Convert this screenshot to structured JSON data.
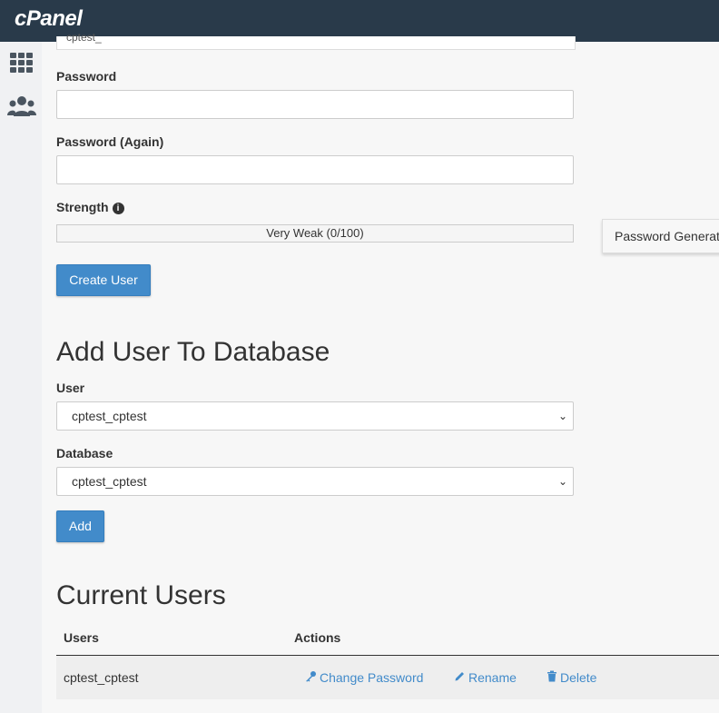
{
  "app": {
    "logo_text": "cPanel"
  },
  "colors": {
    "topbar": "#293a4a",
    "primary": "#428bca",
    "link": "#428bca"
  },
  "sidebar": {
    "items": [
      {
        "icon": "grid-icon"
      },
      {
        "icon": "users-icon"
      }
    ]
  },
  "create_user": {
    "username_partial": "cptest_",
    "password_label": "Password",
    "password_value": "",
    "password_again_label": "Password (Again)",
    "password_again_value": "",
    "strength_label": "Strength",
    "strength_text": "Very Weak (0/100)",
    "strength_value": 0,
    "generator_button": "Password Generat",
    "create_button": "Create User"
  },
  "add_user_to_db": {
    "heading": "Add User To Database",
    "user_label": "User",
    "user_selected": "cptest_cptest",
    "database_label": "Database",
    "database_selected": "cptest_cptest",
    "add_button": "Add"
  },
  "current_users": {
    "heading": "Current Users",
    "columns": [
      "Users",
      "Actions"
    ],
    "rows": [
      {
        "user": "cptest_cptest",
        "actions": [
          "Change Password",
          "Rename",
          "Delete"
        ]
      }
    ]
  }
}
